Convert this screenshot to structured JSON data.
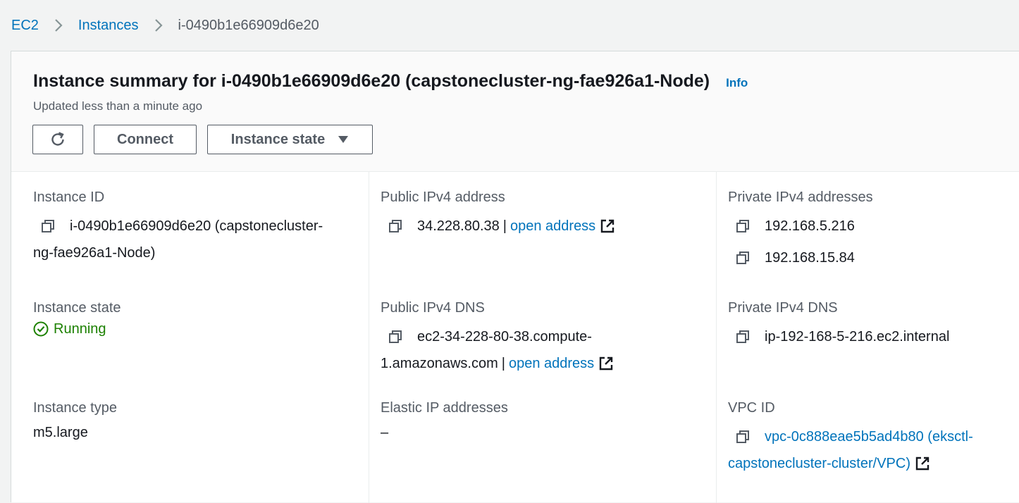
{
  "breadcrumb": {
    "root": "EC2",
    "instances": "Instances",
    "current": "i-0490b1e66909d6e20"
  },
  "header": {
    "title": "Instance summary for i-0490b1e66909d6e20 (capstonecluster-ng-fae926a1-Node)",
    "info": "Info",
    "updated": "Updated less than a minute ago",
    "connect_label": "Connect",
    "instance_state_label": "Instance state"
  },
  "details": {
    "instance_id": {
      "label": "Instance ID",
      "line1": "i-0490b1e66909d6e20 (capstonecluster-",
      "line2": "ng-fae926a1-Node)"
    },
    "public_ipv4": {
      "label": "Public IPv4 address",
      "value": "34.228.80.38",
      "separator": "|",
      "link": "open address"
    },
    "private_ipv4": {
      "label": "Private IPv4 addresses",
      "values": [
        "192.168.5.216",
        "192.168.15.84"
      ]
    },
    "instance_state": {
      "label": "Instance state",
      "value": "Running"
    },
    "public_dns": {
      "label": "Public IPv4 DNS",
      "line1": "ec2-34-228-80-38.compute-",
      "line2": "1.amazonaws.com",
      "separator": "|",
      "link": "open address"
    },
    "private_dns": {
      "label": "Private IPv4 DNS",
      "value": "ip-192-168-5-216.ec2.internal"
    },
    "instance_type": {
      "label": "Instance type",
      "value": "m5.large"
    },
    "elastic_ip": {
      "label": "Elastic IP addresses",
      "value": "–"
    },
    "vpc_id": {
      "label": "VPC ID",
      "line1": "vpc-0c888eae5b5ad4b80 (eksctl-",
      "line2": "capstonecluster-cluster/VPC)"
    }
  },
  "colors": {
    "link": "#0073bb",
    "running": "#1d8102",
    "label": "#545b64"
  },
  "icons": [
    "chevron-right-icon",
    "refresh-icon",
    "caret-down-icon",
    "copy-icon",
    "external-link-icon",
    "status-success-icon"
  ]
}
